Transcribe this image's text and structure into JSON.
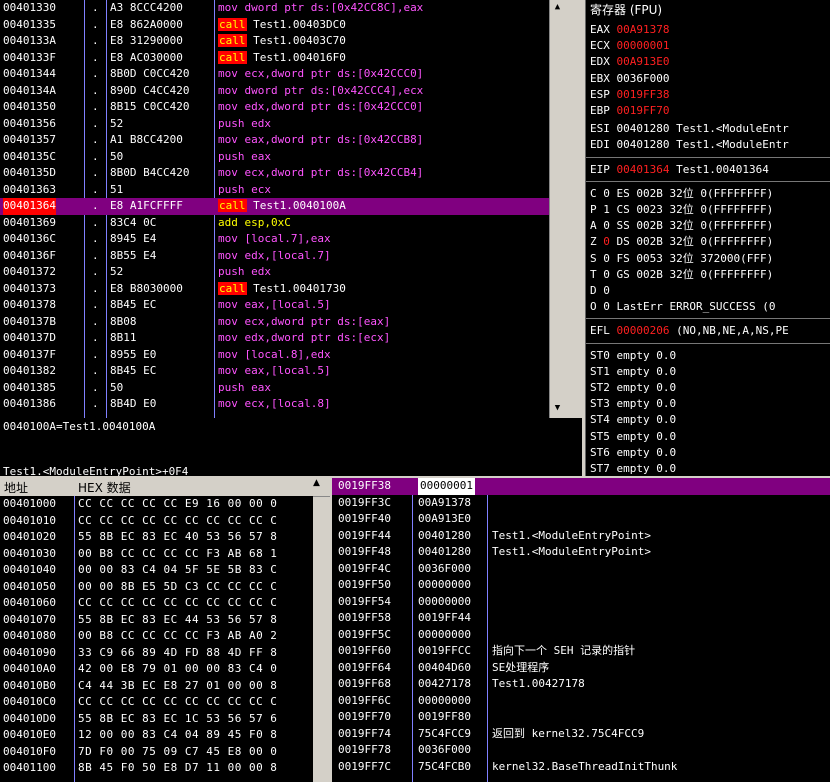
{
  "colors": {
    "selection": "#800080",
    "call_highlight": "#ff0000",
    "register_changed": "#ff2020"
  },
  "disassembly": {
    "rows": [
      {
        "addr": "00401330",
        "mark": ".",
        "bytes": "A3 8CCC4200",
        "op": "mov",
        "args": "dword ptr ds:[0x42CC8C],eax"
      },
      {
        "addr": "00401335",
        "mark": ".",
        "bytes": "E8 862A0000",
        "op": "call",
        "args": "Test1.00403DC0"
      },
      {
        "addr": "0040133A",
        "mark": ".",
        "bytes": "E8 31290000",
        "op": "call",
        "args": "Test1.00403C70"
      },
      {
        "addr": "0040133F",
        "mark": ".",
        "bytes": "E8 AC030000",
        "op": "call",
        "args": "Test1.004016F0"
      },
      {
        "addr": "00401344",
        "mark": ".",
        "bytes": "8B0D C0CC420",
        "op": "mov",
        "args": "ecx,dword ptr ds:[0x42CCC0]"
      },
      {
        "addr": "0040134A",
        "mark": ".",
        "bytes": "890D C4CC420",
        "op": "mov",
        "args": "dword ptr ds:[0x42CCC4],ecx"
      },
      {
        "addr": "00401350",
        "mark": ".",
        "bytes": "8B15 C0CC420",
        "op": "mov",
        "args": "edx,dword ptr ds:[0x42CCC0]"
      },
      {
        "addr": "00401356",
        "mark": ".",
        "bytes": "52",
        "op": "push",
        "args": "edx"
      },
      {
        "addr": "00401357",
        "mark": ".",
        "bytes": "A1 B8CC4200",
        "op": "mov",
        "args": "eax,dword ptr ds:[0x42CCB8]"
      },
      {
        "addr": "0040135C",
        "mark": ".",
        "bytes": "50",
        "op": "push",
        "args": "eax"
      },
      {
        "addr": "0040135D",
        "mark": ".",
        "bytes": "8B0D B4CC420",
        "op": "mov",
        "args": "ecx,dword ptr ds:[0x42CCB4]"
      },
      {
        "addr": "00401363",
        "mark": ".",
        "bytes": "51",
        "op": "push",
        "args": "ecx"
      },
      {
        "addr": "00401364",
        "mark": ".",
        "bytes": "E8 A1FCFFFF",
        "op": "call",
        "args": "Test1.0040100A"
      },
      {
        "addr": "00401369",
        "mark": ".",
        "bytes": "83C4 0C",
        "op": "add",
        "args": "esp,0xC"
      },
      {
        "addr": "0040136C",
        "mark": ".",
        "bytes": "8945 E4",
        "op": "mov",
        "args": "[local.7],eax"
      },
      {
        "addr": "0040136F",
        "mark": ".",
        "bytes": "8B55 E4",
        "op": "mov",
        "args": "edx,[local.7]"
      },
      {
        "addr": "00401372",
        "mark": ".",
        "bytes": "52",
        "op": "push",
        "args": "edx"
      },
      {
        "addr": "00401373",
        "mark": ".",
        "bytes": "E8 B8030000",
        "op": "call",
        "args": "Test1.00401730"
      },
      {
        "addr": "00401378",
        "mark": ".",
        "bytes": "8B45 EC",
        "op": "mov",
        "args": "eax,[local.5]"
      },
      {
        "addr": "0040137B",
        "mark": ".",
        "bytes": "8B08",
        "op": "mov",
        "args": "ecx,dword ptr ds:[eax]"
      },
      {
        "addr": "0040137D",
        "mark": ".",
        "bytes": "8B11",
        "op": "mov",
        "args": "edx,dword ptr ds:[ecx]"
      },
      {
        "addr": "0040137F",
        "mark": ".",
        "bytes": "8955 E0",
        "op": "mov",
        "args": "[local.8],edx"
      },
      {
        "addr": "00401382",
        "mark": ".",
        "bytes": "8B45 EC",
        "op": "mov",
        "args": "eax,[local.5]"
      },
      {
        "addr": "00401385",
        "mark": ".",
        "bytes": "50",
        "op": "push",
        "args": "eax"
      },
      {
        "addr": "00401386",
        "mark": ".",
        "bytes": "8B4D E0",
        "op": "mov",
        "args": "ecx,[local.8]"
      }
    ],
    "selected_addr": "00401364"
  },
  "info": {
    "line1": "0040100A=Test1.0040100A",
    "line2": "Test1.<ModuleEntryPoint>+0F4"
  },
  "registers": {
    "title": "寄存器 (FPU)",
    "gp": [
      {
        "name": "EAX",
        "value": "00A91378",
        "changed": true,
        "comment": ""
      },
      {
        "name": "ECX",
        "value": "00000001",
        "changed": true,
        "comment": ""
      },
      {
        "name": "EDX",
        "value": "00A913E0",
        "changed": true,
        "comment": ""
      },
      {
        "name": "EBX",
        "value": "0036F000",
        "changed": false,
        "comment": ""
      },
      {
        "name": "ESP",
        "value": "0019FF38",
        "changed": true,
        "comment": ""
      },
      {
        "name": "EBP",
        "value": "0019FF70",
        "changed": true,
        "comment": ""
      },
      {
        "name": "ESI",
        "value": "00401280",
        "changed": false,
        "comment": "Test1.<ModuleEntr"
      },
      {
        "name": "EDI",
        "value": "00401280",
        "changed": false,
        "comment": "Test1.<ModuleEntr"
      }
    ],
    "eip": {
      "name": "EIP",
      "value": "00401364",
      "comment": "Test1.00401364"
    },
    "flags": [
      {
        "flag": "C",
        "v": "0",
        "seg": "ES",
        "sel": "002B",
        "bits": "32位",
        "base": "0(FFFFFFFF)",
        "changed": false
      },
      {
        "flag": "P",
        "v": "1",
        "seg": "CS",
        "sel": "0023",
        "bits": "32位",
        "base": "0(FFFFFFFF)",
        "changed": false
      },
      {
        "flag": "A",
        "v": "0",
        "seg": "SS",
        "sel": "002B",
        "bits": "32位",
        "base": "0(FFFFFFFF)",
        "changed": false
      },
      {
        "flag": "Z",
        "v": "0",
        "seg": "DS",
        "sel": "002B",
        "bits": "32位",
        "base": "0(FFFFFFFF)",
        "changed": true
      },
      {
        "flag": "S",
        "v": "0",
        "seg": "FS",
        "sel": "0053",
        "bits": "32位",
        "base": "372000(FFF)",
        "changed": false
      },
      {
        "flag": "T",
        "v": "0",
        "seg": "GS",
        "sel": "002B",
        "bits": "32位",
        "base": "0(FFFFFFFF)",
        "changed": false
      },
      {
        "flag": "D",
        "v": "0",
        "seg": "",
        "sel": "",
        "bits": "",
        "base": "",
        "changed": false
      },
      {
        "flag": "O",
        "v": "0",
        "seg": "LastErr",
        "sel": "ERROR_SUCCESS (0",
        "bits": "",
        "base": "",
        "changed": false
      }
    ],
    "efl": {
      "name": "EFL",
      "value": "00000206",
      "comment": "(NO,NB,NE,A,NS,PE"
    },
    "fpu": [
      {
        "name": "ST0",
        "text": "empty 0.0"
      },
      {
        "name": "ST1",
        "text": "empty 0.0"
      },
      {
        "name": "ST2",
        "text": "empty 0.0"
      },
      {
        "name": "ST3",
        "text": "empty 0.0"
      },
      {
        "name": "ST4",
        "text": "empty 0.0"
      },
      {
        "name": "ST5",
        "text": "empty 0.0"
      },
      {
        "name": "ST6",
        "text": "empty 0.0"
      },
      {
        "name": "ST7",
        "text": "empty 0.0"
      }
    ]
  },
  "hexdump": {
    "col_address": "地址",
    "col_hex": "HEX 数据",
    "rows": [
      {
        "addr": "00401000",
        "bytes": "CC CC CC CC CC E9 16 00 00 0"
      },
      {
        "addr": "00401010",
        "bytes": "CC CC CC CC CC CC CC CC CC C"
      },
      {
        "addr": "00401020",
        "bytes": "55 8B EC 83 EC 40 53 56 57 8"
      },
      {
        "addr": "00401030",
        "bytes": "00 B8 CC CC CC CC F3 AB 68 1"
      },
      {
        "addr": "00401040",
        "bytes": "00 00 83 C4 04 5F 5E 5B 83 C"
      },
      {
        "addr": "00401050",
        "bytes": "00 00 8B E5 5D C3 CC CC CC C"
      },
      {
        "addr": "00401060",
        "bytes": "CC CC CC CC CC CC CC CC CC C"
      },
      {
        "addr": "00401070",
        "bytes": "55 8B EC 83 EC 44 53 56 57 8"
      },
      {
        "addr": "00401080",
        "bytes": "00 B8 CC CC CC CC F3 AB A0 2"
      },
      {
        "addr": "00401090",
        "bytes": "33 C9 66 89 4D FD 88 4D FF 8"
      },
      {
        "addr": "004010A0",
        "bytes": "42 00 E8 79 01 00 00 83 C4 0"
      },
      {
        "addr": "004010B0",
        "bytes": "C4 44 3B EC E8 27 01 00 00 8"
      },
      {
        "addr": "004010C0",
        "bytes": "CC CC CC CC CC CC CC CC CC C"
      },
      {
        "addr": "004010D0",
        "bytes": "55 8B EC 83 EC 1C 53 56 57 6"
      },
      {
        "addr": "004010E0",
        "bytes": "12 00 00 83 C4 04 89 45 F0 8"
      },
      {
        "addr": "004010F0",
        "bytes": "7D F0 00 75 09 C7 45 E8 00 0"
      },
      {
        "addr": "00401100",
        "bytes": "8B 45 F0 50 E8 D7 11 00 00 8"
      }
    ]
  },
  "stack": {
    "rows": [
      {
        "addr": "0019FF38",
        "val": "00000001",
        "cmt": "",
        "cur": true
      },
      {
        "addr": "0019FF3C",
        "val": "00A91378",
        "cmt": "",
        "cur": false
      },
      {
        "addr": "0019FF40",
        "val": "00A913E0",
        "cmt": "",
        "cur": false
      },
      {
        "addr": "0019FF44",
        "val": "00401280",
        "cmt": "Test1.<ModuleEntryPoint>",
        "cur": false
      },
      {
        "addr": "0019FF48",
        "val": "00401280",
        "cmt": "Test1.<ModuleEntryPoint>",
        "cur": false
      },
      {
        "addr": "0019FF4C",
        "val": "0036F000",
        "cmt": "",
        "cur": false
      },
      {
        "addr": "0019FF50",
        "val": "00000000",
        "cmt": "",
        "cur": false
      },
      {
        "addr": "0019FF54",
        "val": "00000000",
        "cmt": "",
        "cur": false
      },
      {
        "addr": "0019FF58",
        "val": "0019FF44",
        "cmt": "",
        "cur": false
      },
      {
        "addr": "0019FF5C",
        "val": "00000000",
        "cmt": "",
        "cur": false
      },
      {
        "addr": "0019FF60",
        "val": "0019FFCC",
        "cmt": "指向下一个 SEH 记录的指针",
        "cur": false
      },
      {
        "addr": "0019FF64",
        "val": "00404D60",
        "cmt": "SE处理程序",
        "cur": false
      },
      {
        "addr": "0019FF68",
        "val": "00427178",
        "cmt": "Test1.00427178",
        "cur": false
      },
      {
        "addr": "0019FF6C",
        "val": "00000000",
        "cmt": "",
        "cur": false
      },
      {
        "addr": "0019FF70",
        "val": "0019FF80",
        "cmt": "",
        "cur": false
      },
      {
        "addr": "0019FF74",
        "val": "75C4FCC9",
        "cmt": "返回到 kernel32.75C4FCC9",
        "cur": false
      },
      {
        "addr": "0019FF78",
        "val": "0036F000",
        "cmt": "",
        "cur": false
      },
      {
        "addr": "0019FF7C",
        "val": "75C4FCB0",
        "cmt": "kernel32.BaseThreadInitThunk",
        "cur": false
      }
    ]
  }
}
